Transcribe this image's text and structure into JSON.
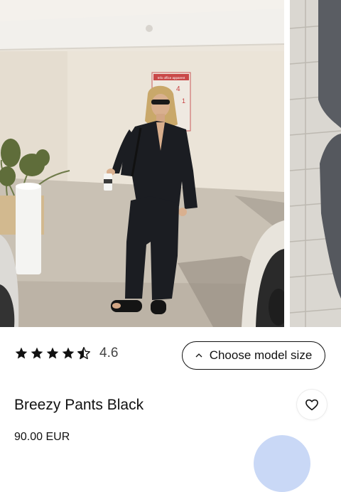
{
  "product": {
    "title": "Breezy Pants Black",
    "price": "90.00 EUR"
  },
  "rating": {
    "value": "4.6",
    "stars_out_of_5": 4.5
  },
  "size_button": {
    "label": "Choose model size"
  },
  "gallery": {
    "poster_text": "Info office apparent",
    "poster_numbers": [
      "4",
      "1"
    ]
  },
  "colors": {
    "accent_fab": "#c9d8f6",
    "star": "#111111",
    "outfit": "#1b1d22"
  },
  "icons": {
    "star": "star-icon",
    "chevron": "chevron-up-icon",
    "heart": "heart-icon"
  }
}
